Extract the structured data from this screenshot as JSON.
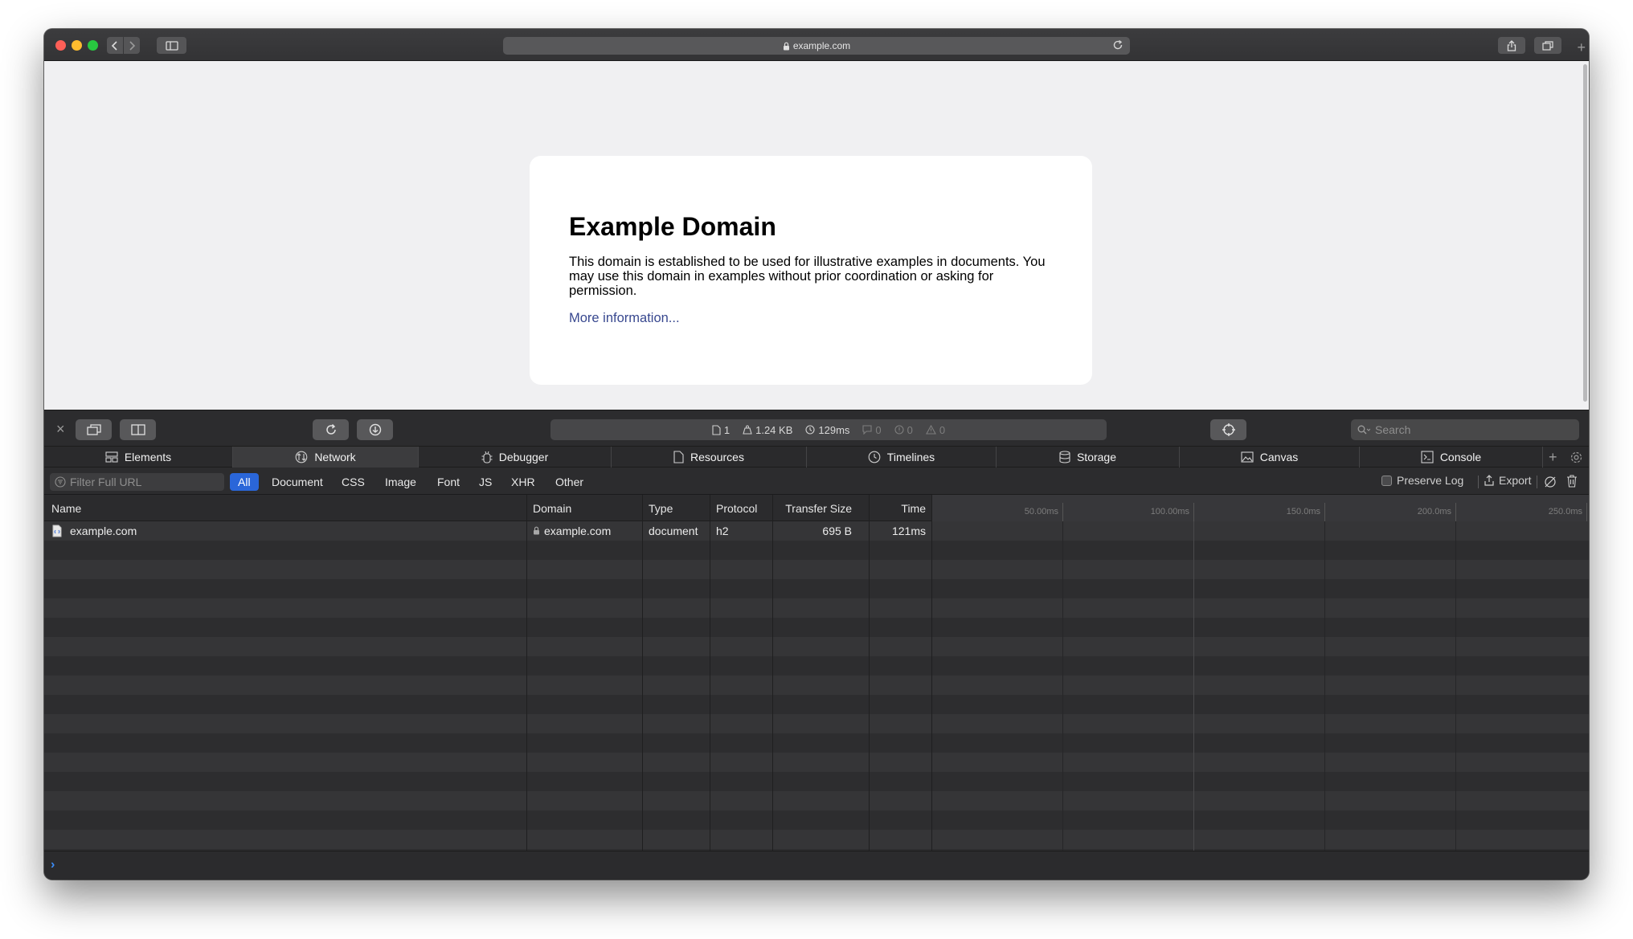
{
  "browser": {
    "address": "example.com"
  },
  "page": {
    "heading": "Example Domain",
    "paragraph": "This domain is established to be used for illustrative examples in documents. You may use this domain in examples without prior coordination or asking for permission.",
    "link": "More information..."
  },
  "devtools": {
    "status": {
      "resources": "1",
      "size": "1.24 KB",
      "time": "129ms",
      "logs": "0",
      "errors": "0",
      "warnings": "0"
    },
    "search_placeholder": "Search",
    "tabs": [
      {
        "label": "Elements"
      },
      {
        "label": "Network"
      },
      {
        "label": "Debugger"
      },
      {
        "label": "Resources"
      },
      {
        "label": "Timelines"
      },
      {
        "label": "Storage"
      },
      {
        "label": "Canvas"
      },
      {
        "label": "Console"
      }
    ],
    "filter": {
      "placeholder": "Filter Full URL",
      "types": [
        "All",
        "Document",
        "CSS",
        "Image",
        "Font",
        "JS",
        "XHR",
        "Other"
      ],
      "preserve_log": "Preserve Log",
      "export": "Export"
    },
    "table": {
      "columns": [
        "Name",
        "Domain",
        "Type",
        "Protocol",
        "Transfer Size",
        "Time"
      ],
      "ticks": [
        "50.00ms",
        "100.00ms",
        "150.0ms",
        "200.0ms",
        "250.0ms"
      ],
      "rows": [
        {
          "name": "example.com",
          "domain": "example.com",
          "type": "document",
          "protocol": "h2",
          "size": "695 B",
          "time": "121ms"
        }
      ]
    }
  }
}
